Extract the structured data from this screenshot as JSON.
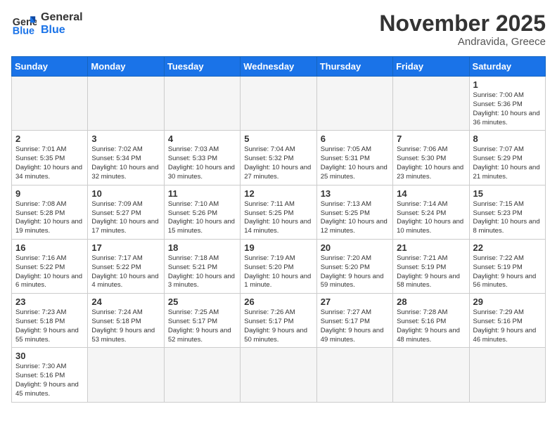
{
  "header": {
    "logo_general": "General",
    "logo_blue": "Blue",
    "month_title": "November 2025",
    "location": "Andravida, Greece"
  },
  "weekdays": [
    "Sunday",
    "Monday",
    "Tuesday",
    "Wednesday",
    "Thursday",
    "Friday",
    "Saturday"
  ],
  "days": {
    "d1": {
      "num": "1",
      "sunrise": "7:00 AM",
      "sunset": "5:36 PM",
      "daylight": "10 hours and 36 minutes."
    },
    "d2": {
      "num": "2",
      "sunrise": "7:01 AM",
      "sunset": "5:35 PM",
      "daylight": "10 hours and 34 minutes."
    },
    "d3": {
      "num": "3",
      "sunrise": "7:02 AM",
      "sunset": "5:34 PM",
      "daylight": "10 hours and 32 minutes."
    },
    "d4": {
      "num": "4",
      "sunrise": "7:03 AM",
      "sunset": "5:33 PM",
      "daylight": "10 hours and 30 minutes."
    },
    "d5": {
      "num": "5",
      "sunrise": "7:04 AM",
      "sunset": "5:32 PM",
      "daylight": "10 hours and 27 minutes."
    },
    "d6": {
      "num": "6",
      "sunrise": "7:05 AM",
      "sunset": "5:31 PM",
      "daylight": "10 hours and 25 minutes."
    },
    "d7": {
      "num": "7",
      "sunrise": "7:06 AM",
      "sunset": "5:30 PM",
      "daylight": "10 hours and 23 minutes."
    },
    "d8": {
      "num": "8",
      "sunrise": "7:07 AM",
      "sunset": "5:29 PM",
      "daylight": "10 hours and 21 minutes."
    },
    "d9": {
      "num": "9",
      "sunrise": "7:08 AM",
      "sunset": "5:28 PM",
      "daylight": "10 hours and 19 minutes."
    },
    "d10": {
      "num": "10",
      "sunrise": "7:09 AM",
      "sunset": "5:27 PM",
      "daylight": "10 hours and 17 minutes."
    },
    "d11": {
      "num": "11",
      "sunrise": "7:10 AM",
      "sunset": "5:26 PM",
      "daylight": "10 hours and 15 minutes."
    },
    "d12": {
      "num": "12",
      "sunrise": "7:11 AM",
      "sunset": "5:25 PM",
      "daylight": "10 hours and 14 minutes."
    },
    "d13": {
      "num": "13",
      "sunrise": "7:13 AM",
      "sunset": "5:25 PM",
      "daylight": "10 hours and 12 minutes."
    },
    "d14": {
      "num": "14",
      "sunrise": "7:14 AM",
      "sunset": "5:24 PM",
      "daylight": "10 hours and 10 minutes."
    },
    "d15": {
      "num": "15",
      "sunrise": "7:15 AM",
      "sunset": "5:23 PM",
      "daylight": "10 hours and 8 minutes."
    },
    "d16": {
      "num": "16",
      "sunrise": "7:16 AM",
      "sunset": "5:22 PM",
      "daylight": "10 hours and 6 minutes."
    },
    "d17": {
      "num": "17",
      "sunrise": "7:17 AM",
      "sunset": "5:22 PM",
      "daylight": "10 hours and 4 minutes."
    },
    "d18": {
      "num": "18",
      "sunrise": "7:18 AM",
      "sunset": "5:21 PM",
      "daylight": "10 hours and 3 minutes."
    },
    "d19": {
      "num": "19",
      "sunrise": "7:19 AM",
      "sunset": "5:20 PM",
      "daylight": "10 hours and 1 minute."
    },
    "d20": {
      "num": "20",
      "sunrise": "7:20 AM",
      "sunset": "5:20 PM",
      "daylight": "9 hours and 59 minutes."
    },
    "d21": {
      "num": "21",
      "sunrise": "7:21 AM",
      "sunset": "5:19 PM",
      "daylight": "9 hours and 58 minutes."
    },
    "d22": {
      "num": "22",
      "sunrise": "7:22 AM",
      "sunset": "5:19 PM",
      "daylight": "9 hours and 56 minutes."
    },
    "d23": {
      "num": "23",
      "sunrise": "7:23 AM",
      "sunset": "5:18 PM",
      "daylight": "9 hours and 55 minutes."
    },
    "d24": {
      "num": "24",
      "sunrise": "7:24 AM",
      "sunset": "5:18 PM",
      "daylight": "9 hours and 53 minutes."
    },
    "d25": {
      "num": "25",
      "sunrise": "7:25 AM",
      "sunset": "5:17 PM",
      "daylight": "9 hours and 52 minutes."
    },
    "d26": {
      "num": "26",
      "sunrise": "7:26 AM",
      "sunset": "5:17 PM",
      "daylight": "9 hours and 50 minutes."
    },
    "d27": {
      "num": "27",
      "sunrise": "7:27 AM",
      "sunset": "5:17 PM",
      "daylight": "9 hours and 49 minutes."
    },
    "d28": {
      "num": "28",
      "sunrise": "7:28 AM",
      "sunset": "5:16 PM",
      "daylight": "9 hours and 48 minutes."
    },
    "d29": {
      "num": "29",
      "sunrise": "7:29 AM",
      "sunset": "5:16 PM",
      "daylight": "9 hours and 46 minutes."
    },
    "d30": {
      "num": "30",
      "sunrise": "7:30 AM",
      "sunset": "5:16 PM",
      "daylight": "9 hours and 45 minutes."
    }
  }
}
